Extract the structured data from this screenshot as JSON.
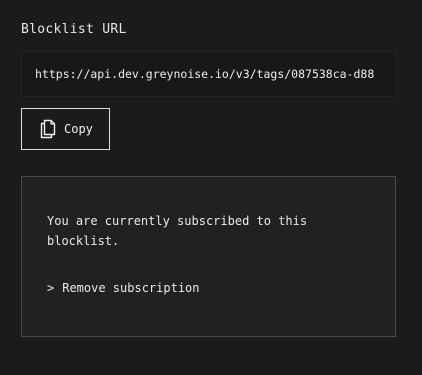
{
  "blocklist": {
    "label": "Blocklist URL",
    "url": "https://api.dev.greynoise.io/v3/tags/087538ca-d88",
    "copy_label": "Copy"
  },
  "subscription": {
    "message": "You are currently subscribed to this blocklist.",
    "remove_chevron": ">",
    "remove_label": "Remove subscription"
  },
  "icons": {
    "copy": "copy-icon",
    "chevron": "chevron-right-icon"
  },
  "colors": {
    "background": "#1b1b1b",
    "panel": "#202123",
    "panel_border": "#4a4a4a",
    "text": "#e8e8e8"
  }
}
